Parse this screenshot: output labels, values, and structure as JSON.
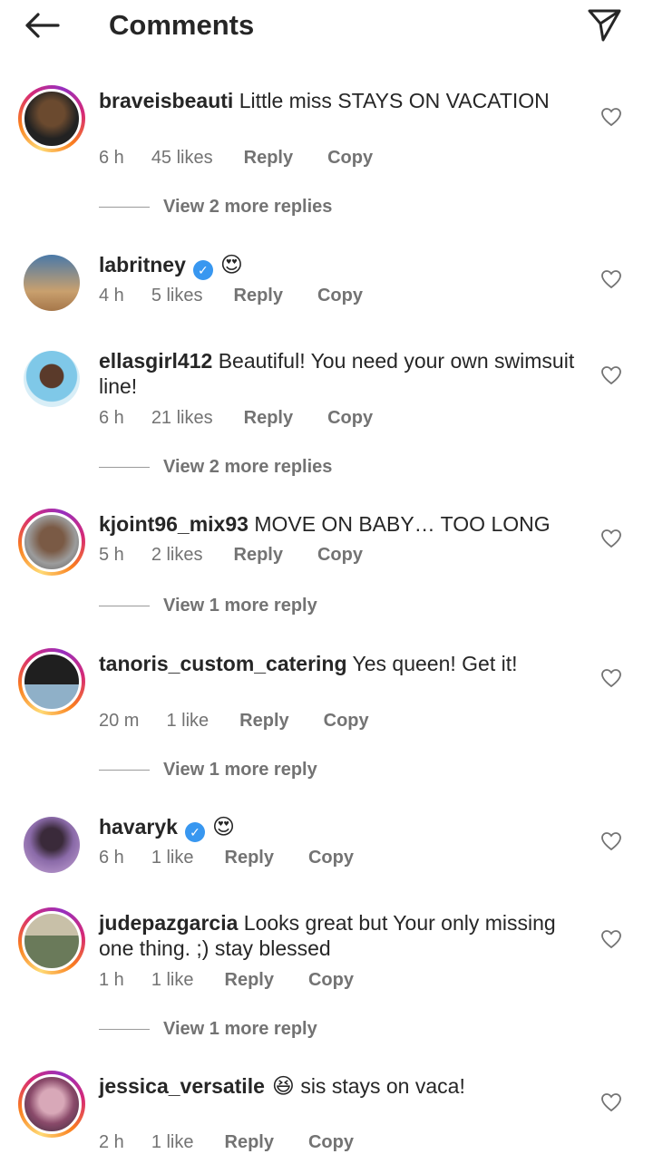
{
  "header": {
    "title": "Comments",
    "back_icon": "arrow-left-icon",
    "send_icon": "paper-plane-icon"
  },
  "comments": [
    {
      "username": "braveisbeauti",
      "text": "Little miss STAYS ON VACATION",
      "verified": false,
      "emoji": "",
      "time": "6 h",
      "likes": "45 likes",
      "reply": "Reply",
      "copy": "Copy",
      "view_more": "View 2 more replies",
      "ring": true
    },
    {
      "username": "labritney",
      "text": "",
      "verified": true,
      "emoji": "😍",
      "time": "4 h",
      "likes": "5 likes",
      "reply": "Reply",
      "copy": "Copy",
      "view_more": "",
      "ring": false
    },
    {
      "username": "ellasgirl412",
      "text": "Beautiful! You need your own swimsuit line!",
      "verified": false,
      "emoji": "",
      "time": "6 h",
      "likes": "21 likes",
      "reply": "Reply",
      "copy": "Copy",
      "view_more": "View 2 more replies",
      "ring": false
    },
    {
      "username": "kjoint96_mix93",
      "text": "MOVE ON BABY… TOO LONG",
      "verified": false,
      "emoji": "",
      "time": "5 h",
      "likes": "2 likes",
      "reply": "Reply",
      "copy": "Copy",
      "view_more": "View 1 more reply",
      "ring": true
    },
    {
      "username": "tanoris_custom_catering",
      "text": "Yes queen! Get it!",
      "verified": false,
      "emoji": "",
      "time": "20 m",
      "likes": "1 like",
      "reply": "Reply",
      "copy": "Copy",
      "view_more": "View 1 more reply",
      "ring": true
    },
    {
      "username": "havaryk",
      "text": "",
      "verified": true,
      "emoji": "😍",
      "time": "6 h",
      "likes": "1 like",
      "reply": "Reply",
      "copy": "Copy",
      "view_more": "",
      "ring": false
    },
    {
      "username": "judepazgarcia",
      "text": "Looks great but Your only missing one thing. ;) stay blessed",
      "verified": false,
      "emoji": "",
      "time": "1 h",
      "likes": "1 like",
      "reply": "Reply",
      "copy": "Copy",
      "view_more": "View 1 more reply",
      "ring": true
    },
    {
      "username": "jessica_versatile",
      "text": "sis stays on vaca!",
      "verified": false,
      "emoji": "😆",
      "time": "2 h",
      "likes": "1 like",
      "reply": "Reply",
      "copy": "Copy",
      "view_more": "",
      "ring": true
    }
  ],
  "colors": {
    "text": "#262626",
    "meta": "#737373",
    "verified": "#3897f0"
  }
}
